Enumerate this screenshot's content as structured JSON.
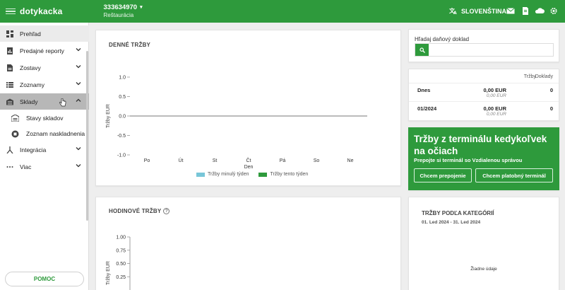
{
  "app": {
    "logo": "dotykacka"
  },
  "account": {
    "number": "333634970",
    "caret": "▾",
    "name": "Reštaurácia"
  },
  "topbar": {
    "language": "SLOVENŠTINA",
    "icons": [
      "translate-icon",
      "mail-icon",
      "document-icon",
      "cloud-icon",
      "gear-icon"
    ]
  },
  "sidebar": {
    "items": [
      {
        "label": "Prehľad",
        "icon": "dashboard-icon"
      },
      {
        "label": "Predajné reporty",
        "icon": "report-icon"
      },
      {
        "label": "Zostavy",
        "icon": "document-icon"
      },
      {
        "label": "Zoznamy",
        "icon": "list-icon"
      },
      {
        "label": "Sklady",
        "icon": "warehouse-icon"
      },
      {
        "label": "Integrácia",
        "icon": "integration-icon"
      },
      {
        "label": "Viac",
        "icon": "more-icon"
      }
    ],
    "subitems": [
      {
        "label": "Stavy skladov",
        "icon": "warehouse-icon"
      },
      {
        "label": "Zoznam naskladnenia",
        "icon": "box-icon"
      }
    ],
    "help": "POMOC"
  },
  "daily_sales": {
    "title": "DENNÉ TRŽBY",
    "ylabel": "Tržby EUR",
    "xlabel": "Den",
    "yticks": [
      "1.0",
      "0.5",
      "0.0",
      "-0.5",
      "-1.0"
    ],
    "legend": [
      "Tržby minulý týden",
      "Tržby tento týden"
    ]
  },
  "hourly_sales": {
    "title": "HODINOVÉ TRŽBY",
    "info": "?",
    "ylabel": "Tržby EUR",
    "yticks": [
      "1.00",
      "0.75",
      "0.50",
      "0.25"
    ]
  },
  "search": {
    "label": "Hľadaj daňový doklad",
    "placeholder": ""
  },
  "sales_table": {
    "headers": {
      "sales": "Tržby",
      "receipts": "Doklady"
    },
    "rows": [
      {
        "label": "Dnes",
        "sales": "0,00 EUR",
        "sales_sub": "0,00 EUR",
        "receipts": "0"
      },
      {
        "label": "01/2024",
        "sales": "0,00 EUR",
        "sales_sub": "0,00 EUR",
        "receipts": "0"
      }
    ]
  },
  "promo": {
    "title": "Tržby z terminálu kedykoľvek na očiach",
    "subtitle": "Prepojte si terminál so Vzdialenou správou",
    "btn_connect": "Chcem prepojenie",
    "btn_terminal": "Chcem platobný terminál"
  },
  "categories": {
    "title": "TRŽBY PODĽA KATEGÓRIÍ",
    "date_range": "01. Led 2024 - 31. Led 2024",
    "empty": "Žiadne údaje"
  },
  "chart_data": [
    {
      "type": "bar",
      "title": "DENNÉ TRŽBY",
      "xlabel": "Den",
      "ylabel": "Tržby EUR",
      "categories": [
        "Po",
        "Út",
        "St",
        "Čt",
        "Pá",
        "So",
        "Ne"
      ],
      "ylim": [
        -1.0,
        1.0
      ],
      "series": [
        {
          "name": "Tržby minulý týden",
          "color": "#78c6d8",
          "values": [
            0,
            0,
            0,
            0,
            0,
            0,
            0
          ]
        },
        {
          "name": "Tržby tento týden",
          "color": "#2e9a3c",
          "values": [
            0,
            0,
            0,
            0,
            0,
            0,
            0
          ]
        }
      ],
      "legend": "bottom"
    },
    {
      "type": "bar",
      "title": "HODINOVÉ TRŽBY",
      "ylabel": "Tržby EUR",
      "ylim": [
        0,
        1.0
      ],
      "series": []
    }
  ],
  "colors": {
    "brand": "#2e9a3c",
    "last_week": "#78c6d8",
    "this_week": "#2e9a3c"
  }
}
